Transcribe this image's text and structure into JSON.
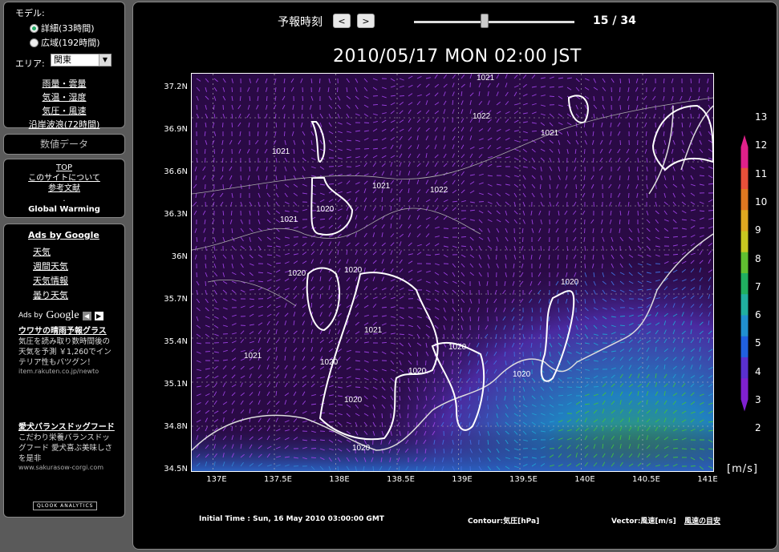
{
  "sidebar": {
    "model_label": "モデル:",
    "model_options": [
      {
        "label": "詳細(33時間)",
        "selected": true
      },
      {
        "label": "広域(192時間)",
        "selected": false
      }
    ],
    "area_label": "エリア:",
    "area_value": "関東",
    "menu": [
      "雨量・雲量",
      "気温・湿度",
      "気圧・風速",
      "沿岸波浪(72時間)"
    ],
    "numeric_data": "数値データ",
    "links": [
      "TOP",
      "このサイトについて",
      "参考文献",
      ".",
      "Global Warming"
    ]
  },
  "ads": {
    "title": "Ads by Google",
    "items": [
      "天気",
      "週間天気",
      "天気情報",
      "曇り天気"
    ],
    "ads_by": "Ads by",
    "google": "Google",
    "ad1": {
      "head": "ウワサの晴雨予報グラス",
      "body": "気圧を読み取り数時間後の天気を予測 ￥1,260でインテリア性もバツグン！",
      "url": "item.rakuten.co.jp/newto"
    },
    "ad2": {
      "head": "愛犬バランスドッグフード",
      "body": "こだわり栄養バランスドッグフード 愛犬喜ぶ美味しさを是非",
      "url": "www.sakurasow-corgi.com"
    },
    "analytics": "QLOOK ANALYTICS"
  },
  "header": {
    "forecast_label": "予報時刻",
    "prev": "<",
    "next": ">",
    "frame": "15 / 34",
    "slider_fraction": 0.44
  },
  "map": {
    "title": "2010/05/17 MON 02:00 JST",
    "y_ticks": [
      "37.2N",
      "36.9N",
      "36.6N",
      "36.3N",
      "36N",
      "35.7N",
      "35.4N",
      "35.1N",
      "34.8N",
      "34.5N"
    ],
    "x_ticks": [
      "137E",
      "137.5E",
      "138E",
      "138.5E",
      "139E",
      "139.5E",
      "140E",
      "140.5E",
      "141E"
    ],
    "contour_labels": [
      "1021",
      "1022",
      "1021",
      "1021",
      "1021",
      "1022",
      "1020",
      "1021",
      "1020",
      "1020",
      "1021",
      "1021",
      "1020",
      "1020",
      "1020",
      "1020",
      "1020",
      "1020",
      "1020"
    ],
    "colorbar_labels": [
      "13",
      "12",
      "11",
      "10",
      "9",
      "8",
      "7",
      "6",
      "5",
      "4",
      "3",
      "2"
    ],
    "colorbar_colors": [
      "#e0208a",
      "#e8503a",
      "#e07820",
      "#e0a820",
      "#c8c820",
      "#60c030",
      "#20b060",
      "#20b0a0",
      "#2090d0",
      "#2060e0",
      "#5a30d0",
      "#8020d0"
    ],
    "units": "[m/s]"
  },
  "footer": {
    "initial_time": "Initial Time : Sun, 16 May 2010 03:00:00 GMT",
    "contour": "Contour:気圧[hPa]",
    "vector": "Vector:風速[m/s]",
    "wind_guide": "風速の目安"
  }
}
